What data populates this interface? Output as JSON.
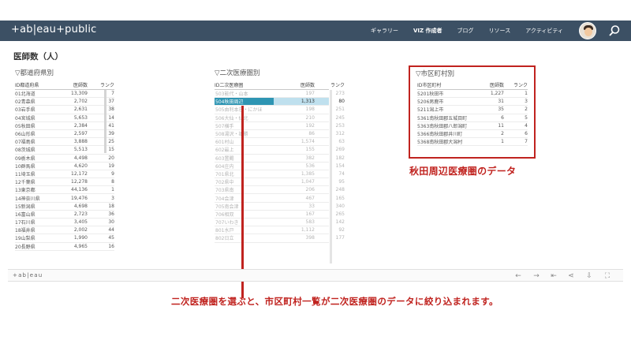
{
  "topbar": {
    "logo": "+ab|eau+public",
    "nav": [
      "ギャラリー",
      "VIZ 作成者",
      "ブログ",
      "リソース",
      "アクティビティ"
    ]
  },
  "page_title": "医師数（人）",
  "prefecture": {
    "title": "▽都道府県別",
    "headers": [
      "ID都道府県",
      "医師数",
      "ランク"
    ],
    "rows": [
      [
        "01北海道",
        "13,309",
        "7"
      ],
      [
        "02青森県",
        "2,702",
        "37"
      ],
      [
        "03岩手県",
        "2,631",
        "38"
      ],
      [
        "04宮城県",
        "5,653",
        "14"
      ],
      [
        "05秋田県",
        "2,384",
        "41"
      ],
      [
        "06山形県",
        "2,597",
        "39"
      ],
      [
        "07福島県",
        "3,888",
        "25"
      ],
      [
        "08茨城県",
        "5,513",
        "15"
      ],
      [
        "09栃木県",
        "4,498",
        "20"
      ],
      [
        "10群馬県",
        "4,620",
        "19"
      ],
      [
        "11埼玉県",
        "12,172",
        "9"
      ],
      [
        "12千葉県",
        "12,278",
        "8"
      ],
      [
        "13東京都",
        "44,136",
        "1"
      ],
      [
        "14神奈川県",
        "19,476",
        "3"
      ],
      [
        "15新潟県",
        "4,698",
        "18"
      ],
      [
        "16富山県",
        "2,723",
        "36"
      ],
      [
        "17石川県",
        "3,405",
        "30"
      ],
      [
        "18福井県",
        "2,002",
        "44"
      ],
      [
        "19山梨県",
        "1,990",
        "45"
      ],
      [
        "20長野県",
        "4,965",
        "16"
      ]
    ]
  },
  "secondary": {
    "title": "▽二次医療圏別",
    "headers": [
      "ID二次医療圏",
      "医師数",
      "ランク"
    ],
    "rows": [
      [
        "503能代・山本",
        "197",
        "273"
      ],
      [
        "504秋田周辺",
        "1,313",
        "80"
      ],
      [
        "505由利本荘・にかほ",
        "198",
        "251"
      ],
      [
        "506大仙・仙北",
        "210",
        "245"
      ],
      [
        "507横手",
        "192",
        "253"
      ],
      [
        "508湯沢・雄勝",
        "86",
        "312"
      ],
      [
        "601村山",
        "1,574",
        "63"
      ],
      [
        "602最上",
        "155",
        "269"
      ],
      [
        "603置賜",
        "382",
        "182"
      ],
      [
        "604庄内",
        "536",
        "154"
      ],
      [
        "701県北",
        "1,385",
        "74"
      ],
      [
        "702県中",
        "1,047",
        "95"
      ],
      [
        "703県南",
        "206",
        "248"
      ],
      [
        "704会津",
        "467",
        "165"
      ],
      [
        "705南会津",
        "33",
        "340"
      ],
      [
        "706相双",
        "167",
        "265"
      ],
      [
        "707いわき",
        "583",
        "142"
      ],
      [
        "801水戸",
        "1,112",
        "92"
      ],
      [
        "802日立",
        "398",
        "177"
      ]
    ]
  },
  "municipal": {
    "title": "▽市区町村別",
    "headers": [
      "ID市区町村",
      "医師数",
      "ランク"
    ],
    "rows": [
      [
        "5201秋田市",
        "1,227",
        "1"
      ],
      [
        "5206男鹿市",
        "31",
        "3"
      ],
      [
        "5211潟上市",
        "35",
        "2"
      ],
      [
        "5361南秋田郡五城目町",
        "6",
        "5"
      ],
      [
        "5363南秋田郡八郎潟町",
        "11",
        "4"
      ],
      [
        "5366南秋田郡井川町",
        "2",
        "6"
      ],
      [
        "5368南秋田郡大潟村",
        "1",
        "7"
      ]
    ]
  },
  "annotations": {
    "box_label": "秋田周辺医療圏のデータ",
    "bottom": "二次医療圏を選ぶと、市区町村一覧が二次医療圏のデータに絞り込まれます。"
  },
  "footer": {
    "logo": "+ab|eau",
    "icons": [
      "undo-icon",
      "redo-icon",
      "revert-icon",
      "share-icon",
      "download-icon",
      "fullscreen-icon"
    ]
  },
  "colors": {
    "topbar": "#3c5064",
    "selected": "#2e95b3",
    "annotation": "#c0231f"
  }
}
